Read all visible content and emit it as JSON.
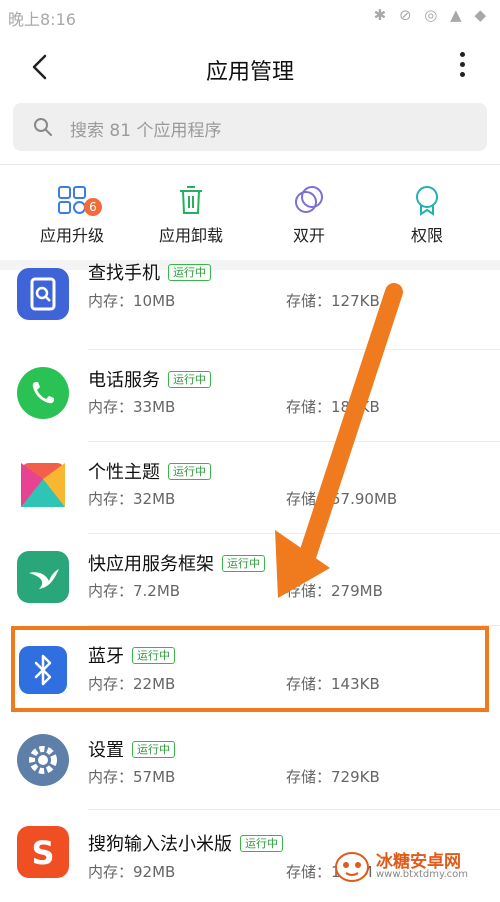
{
  "status": {
    "time": "晚上8:16",
    "icons": "✱ ⊘ ◎ ▲ ◆"
  },
  "header": {
    "title": "应用管理"
  },
  "search": {
    "placeholder": "搜索 81 个应用程序"
  },
  "tools": [
    {
      "label": "应用升级",
      "icon": "apps-grid-icon",
      "badge": "6"
    },
    {
      "label": "应用卸载",
      "icon": "trash-icon"
    },
    {
      "label": "双开",
      "icon": "dual-circle-icon"
    },
    {
      "label": "权限",
      "icon": "badge-ribbon-icon"
    }
  ],
  "apps": [
    {
      "name": "查找手机",
      "tag": "运行中",
      "mem": "内存：10MB",
      "sto": "存储：127KB",
      "icon": "find-phone-icon",
      "color": "#3e64d8"
    },
    {
      "name": "电话服务",
      "tag": "运行中",
      "mem": "内存：33MB",
      "sto": "存储：184KB",
      "icon": "phone-icon",
      "color": "#2bc255"
    },
    {
      "name": "个性主题",
      "tag": "运行中",
      "mem": "内存：32MB",
      "sto": "存储：57.90MB",
      "icon": "theme-icon",
      "color": "#f35f4a"
    },
    {
      "name": "快应用服务框架",
      "tag": "运行中",
      "mem": "内存：7.2MB",
      "sto": "存储：279MB",
      "icon": "quick-app-icon",
      "color": "#2aa77a"
    },
    {
      "name": "蓝牙",
      "tag": "运行中",
      "mem": "内存：22MB",
      "sto": "存储：143KB",
      "icon": "bluetooth-icon",
      "color": "#2f6fe0"
    },
    {
      "name": "设置",
      "tag": "运行中",
      "mem": "内存：57MB",
      "sto": "存储：729KB",
      "icon": "settings-gear-icon",
      "color": "#5e7fa8"
    },
    {
      "name": "搜狗输入法小米版",
      "tag": "运行中",
      "mem": "内存：92MB",
      "sto": "存储：110M",
      "icon": "sogou-icon",
      "color": "#f04e23"
    }
  ],
  "watermark": {
    "title": "冰糖安卓网",
    "url": "www.btxtdmy.com"
  },
  "colors": {
    "accent": "#f07a1e",
    "running": "#39b54a"
  }
}
